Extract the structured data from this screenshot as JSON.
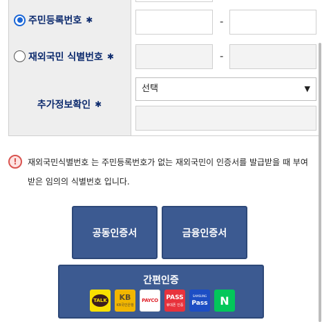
{
  "form": {
    "row1": {
      "label": "주민등록번호",
      "star": "✱",
      "dash": "-"
    },
    "row2": {
      "label": "재외국민 식별번호",
      "star": "✱",
      "dash": "-"
    },
    "row3": {
      "label": "추가정보확인",
      "star": "✱",
      "select_value": "선택",
      "select_arrow": "▼"
    }
  },
  "notice": {
    "icon_text": "!",
    "line1": "재외국민식별번호 는 주민등록번호가 없는 재외국민이 인증서를 발급받을 때 부여",
    "line2": "받은 임의의 식별번호 입니다."
  },
  "buttons": {
    "joint_cert": "공동인증서",
    "finance_cert": "금융인증서",
    "easy_auth": "간편인증"
  },
  "easy_logos": {
    "kakao": "TALK",
    "kb": "KB",
    "kb_sub": "KB국민은행",
    "payco": "PAYCO",
    "pass": "PASS",
    "pass_sub": "휴대폰 인증",
    "samsung_top": "SAMSUNG",
    "samsung": "Pass",
    "naver": "N"
  },
  "colors": {
    "brand_navy": "#3c5a91",
    "label_navy": "#0d2b6e",
    "radio_blue": "#1a66d6",
    "warn_red": "#d9534f"
  }
}
